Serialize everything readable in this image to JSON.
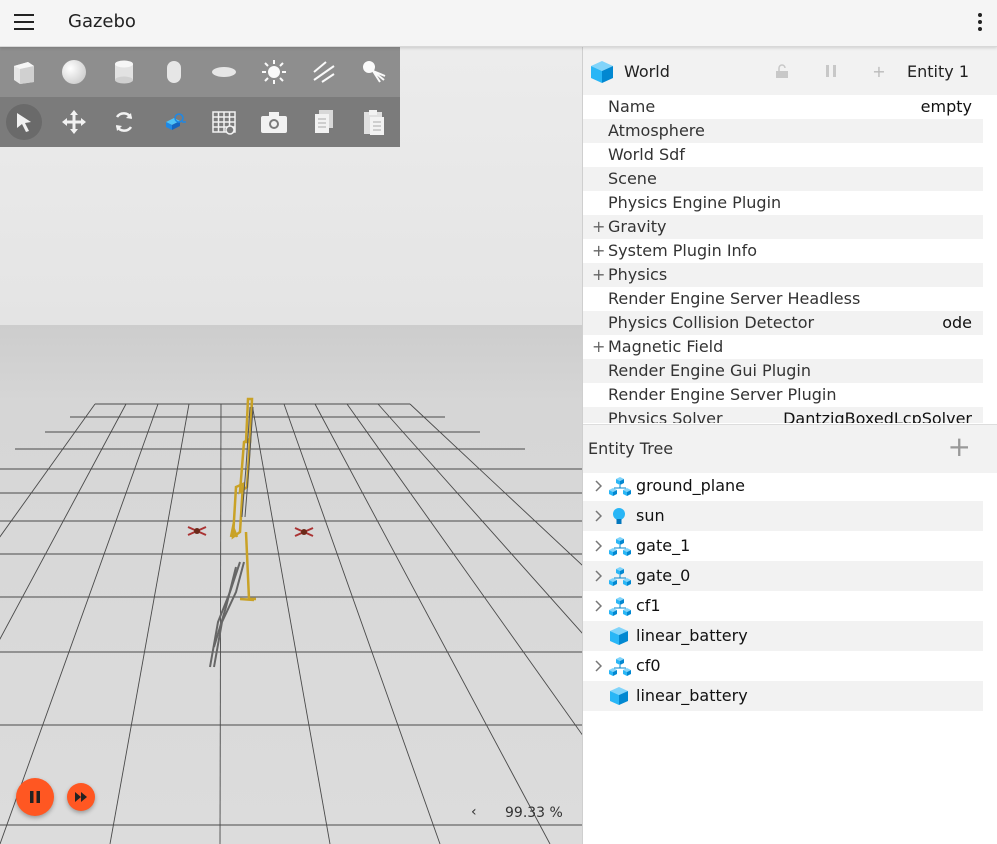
{
  "app": {
    "title": "Gazebo"
  },
  "toolbar": {
    "row1": [
      "box-icon",
      "sphere-icon",
      "cylinder-icon",
      "capsule-icon",
      "ellipsoid-icon",
      "sun-icon",
      "directional-light-icon",
      "spot-light-icon"
    ],
    "row2": [
      "select-arrow-icon",
      "translate-icon",
      "rotate-icon",
      "transform-control-icon",
      "grid-icon",
      "screenshot-icon",
      "copy-icon",
      "paste-icon"
    ]
  },
  "component_inspector": {
    "title": "World",
    "entity_label": "Entity 1",
    "properties": [
      {
        "label": "Name",
        "value": "empty",
        "expandable": false
      },
      {
        "label": "Atmosphere",
        "value": "",
        "expandable": false
      },
      {
        "label": "World Sdf",
        "value": "",
        "expandable": false
      },
      {
        "label": "Scene",
        "value": "",
        "expandable": false
      },
      {
        "label": "Physics Engine Plugin",
        "value": "",
        "expandable": false
      },
      {
        "label": "Gravity",
        "value": "",
        "expandable": true
      },
      {
        "label": "System Plugin Info",
        "value": "",
        "expandable": true
      },
      {
        "label": "Physics",
        "value": "",
        "expandable": true
      },
      {
        "label": "Render Engine Server Headless",
        "value": "",
        "expandable": false
      },
      {
        "label": "Physics Collision Detector",
        "value": "ode",
        "expandable": false
      },
      {
        "label": "Magnetic Field",
        "value": "",
        "expandable": true
      },
      {
        "label": "Render Engine Gui Plugin",
        "value": "",
        "expandable": false
      },
      {
        "label": "Render Engine Server Plugin",
        "value": "",
        "expandable": false
      },
      {
        "label": "Physics Solver",
        "value": "DantzigBoxedLcpSolver",
        "expandable": false
      }
    ],
    "expand_symbol": "+"
  },
  "entity_tree": {
    "title": "Entity Tree",
    "add_symbol": "+",
    "items": [
      {
        "label": "ground_plane",
        "icon": "model-icon",
        "expandable": true
      },
      {
        "label": "sun",
        "icon": "light-bulb-icon",
        "expandable": true
      },
      {
        "label": "gate_1",
        "icon": "model-icon",
        "expandable": true
      },
      {
        "label": "gate_0",
        "icon": "model-icon",
        "expandable": true
      },
      {
        "label": "cf1",
        "icon": "model-icon",
        "expandable": true
      },
      {
        "label": "linear_battery",
        "icon": "cube-icon",
        "expandable": false
      },
      {
        "label": "cf0",
        "icon": "model-icon",
        "expandable": true
      },
      {
        "label": "linear_battery",
        "icon": "cube-icon",
        "expandable": false
      }
    ]
  },
  "sim": {
    "rtf_value": "99.33 %",
    "rtf_arrow": "‹"
  },
  "colors": {
    "accent": "#ff5722",
    "entity_blue": "#29b6f6",
    "toolbar": "#8e8e8e"
  }
}
